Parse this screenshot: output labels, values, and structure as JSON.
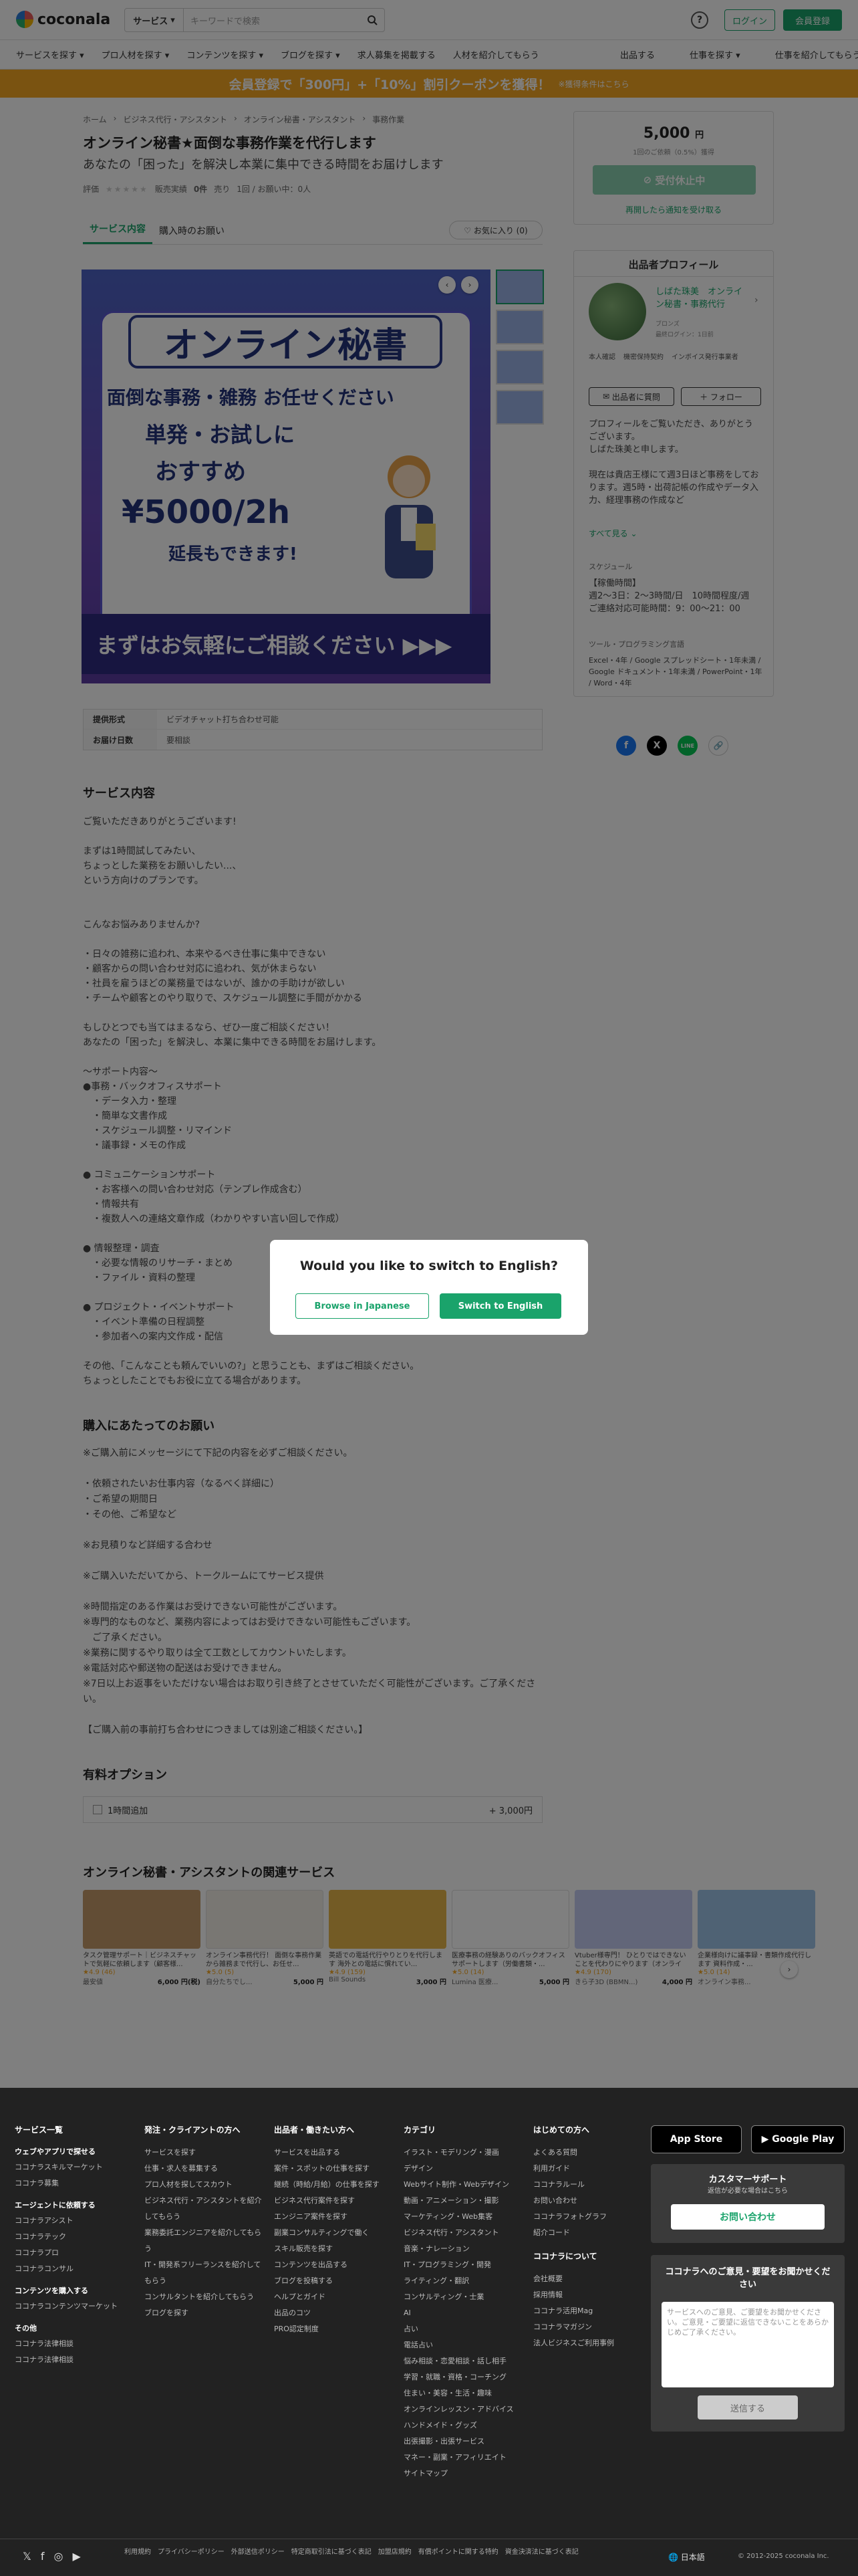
{
  "header": {
    "logo": "coconala",
    "search_category": "サービス",
    "search_placeholder": "キーワードで検索",
    "login": "ログイン",
    "register": "会員登録"
  },
  "nav": {
    "left": [
      "サービスを探す ▾",
      "プロ人材を探す ▾",
      "コンテンツを探す ▾",
      "ブログを探す ▾",
      "求人募集を掲載する",
      "人材を紹介してもらう"
    ],
    "right": [
      "出品する",
      "仕事を探す ▾",
      "仕事を紹介してもらう ▾"
    ]
  },
  "banner": {
    "text": "会員登録で「300円」+「10%」割引クーポンを獲得！",
    "sub": "※獲得条件はこちら"
  },
  "breadcrumb": [
    "ホーム",
    "ビジネス代行・アシスタント",
    "オンライン秘書・アシスタント",
    "事務作業"
  ],
  "title": "オンライン秘書★面倒な事務作業を代行します",
  "subtitle": "あなたの「困った」を解決し本業に集中できる時間をお届けします",
  "meta": {
    "rating_label": "評価",
    "stars": "★★★★★",
    "sales_label": "販売実績",
    "sales": "0件",
    "likes_label": "売り",
    "reply": "1回 / お願い中：0人"
  },
  "tabs": [
    "サービス内容",
    "購入時のお願い"
  ],
  "favorite": "♡ お気に入り (0)",
  "hero": {
    "big": "オンライン秘書",
    "l1": "面倒な事務・雑務 お任せください",
    "l2": "単発・お試しに",
    "l3": "おすすめ",
    "l4": "¥5000/2h",
    "l5": "延長もできます!",
    "foot": "まずはお気軽にご相談ください ▶▶▶"
  },
  "spec": [
    {
      "k": "提供形式",
      "v": "ビデオチャット打ち合わせ可能"
    },
    {
      "k": "お届け日数",
      "v": "要相談"
    }
  ],
  "desc_title": "サービス内容",
  "desc": "ご覧いただきありがとうございます!\n\nまずは1時間試してみたい、\nちょっとした業務をお願いしたい...、\nという方向けのプランです。\n\n\nこんなお悩みありませんか?\n\n・日々の雑務に追われ、本来やるべき仕事に集中できない\n・顧客からの問い合わせ対応に追われ、気が休まらない\n・社員を雇うほどの業務量ではないが、誰かの手助けが欲しい\n・チームや顧客とのやり取りで、スケジュール調整に手間がかかる\n\nもしひとつでも当てはまるなら、ぜひ一度ご相談ください！\nあなたの「困った」を解決し、本業に集中できる時間をお届けします。\n\n〜サポート内容〜\n●事務・バックオフィスサポート\n　・データ入力・整理\n　・簡単な文書作成\n　・スケジュール調整・リマインド\n　・議事録・メモの作成\n\n● コミュニケーションサポート\n　・お客様への問い合わせ対応（テンプレ作成含む）\n　・情報共有\n　・複数人への連絡文章作成（わかりやすい言い回しで作成）\n\n● 情報整理・調査\n　・必要な情報のリサーチ・まとめ\n　・ファイル・資料の整理\n\n● プロジェクト・イベントサポート\n　・イベント準備の日程調整\n　・参加者への案内文作成・配信\n\nその他、「こんなことも頼んでいいの?」と思うことも、まずはご相談ください。\nちょっとしたことでもお役に立てる場合があります。",
  "notes_title": "購入にあたってのお願い",
  "notes": "※ご購入前にメッセージにて下記の内容を必ずご相談ください。\n\n・依頼されたいお仕事内容（なるべく詳細に）\n・ご希望の期間日\n・その他、ご希望など\n\n※お見積りなど詳細する合わせ\n\n※ご購入いただいてから、トークルームにてサービス提供\n\n※時間指定のある作業はお受けできない可能性がございます。\n※専門的なものなど、業務内容によってはお受けできない可能性もございます。\n　ご了承ください。\n※業務に関するやり取りは全て工数としてカウントいたします。\n※電話対応や郵送物の配送はお受けできません。\n※7日以上お返事をいただけない場合はお取り引き終了とさせていただく可能性がございます。ご了承ください。\n\n【ご購入前の事前打ち合わせにつきましては別途ご相談ください。】",
  "option_title": "有料オプション",
  "option": {
    "label": "1時間追加",
    "price": "+ 3,000円"
  },
  "related_title": "オンライン秘書・アシスタントの関連サービス",
  "related": [
    {
      "t": "タスク管理サポート｜ビジネスチャットで気軽に依頼します（顧客様...",
      "r": "★4.9 (46)",
      "s": "最安値",
      "p": "6,000 円(税)",
      "c": "#c59a6b"
    },
    {
      "t": "オンライン事務代行！ 面倒な事務作業から雑務まで代行し、お任せ...",
      "r": "★5.0 (5)",
      "s": "自分たちでし...",
      "p": "5,000 円",
      "c": "#f2efe6"
    },
    {
      "t": "英語での電話代行やりとりを代行します 海外との電話に慣れてい...",
      "r": "★4.9 (159)",
      "s": "Bill Sounds",
      "p": "3,000 円",
      "c": "#e7b64a"
    },
    {
      "t": "医療事務の経験ありのバックオフィスサポートします（労働書類・...",
      "r": "★5.0 (14)",
      "s": "Lumina 医療...",
      "p": "5,000 円",
      "c": "#fff"
    },
    {
      "t": "Vtuber様専門！ ひとりではできないことを代わりにやります（オンライン...",
      "r": "★4.9 (170)",
      "s": "きら子3D (BBMN...)",
      "p": "4,000 円",
      "c": "#c4cdf3"
    },
    {
      "t": "企業様向けに議事録・書類作成代行します 資料作成・...",
      "r": "★5.0 (14)",
      "s": "オンライン事務...",
      "p": "",
      "c": "#9fc4e8"
    }
  ],
  "seller": {
    "price": "5,000",
    "yen": "円",
    "note": "1回のご依頼（0.5%）獲得",
    "stop": "受付休止中",
    "link": "再開したら通知を受け取る",
    "profile_title": "出品者プロフィール",
    "name": "しばた珠美　オンライン秘書・事務代行",
    "rank": "ブロンズ",
    "login": "最終ログイン：1日前",
    "ids": [
      "本人確認",
      "機密保持契約",
      "インボイス発行事業者"
    ],
    "msg": "出品者に質問",
    "follow": "＋ フォロー",
    "intro": "プロフィールをご覧いただき、ありがとうございます。\nしばた珠美と申します。\n\n現在は貴店王様にて週3日ほど事務をしております。週5時・出荷記帳の作成やデータ入力、経理事務の作成など",
    "more": "すべて見る ⌄",
    "sched_label": "スケジュール",
    "sched": "【稼働時間】\n週2〜3日：2〜3時間/日　10時間程度/週\nご連絡対応可能時間：9：00〜21：00",
    "skill_label": "ツール・プログラミング言語",
    "skill": "Excel・4年 / Google スプレッドシート・1年未満 / Google ドキュメント・1年未満 / PowerPoint・1年 / Word・4年"
  },
  "share": [
    "f",
    "X",
    "LINE",
    "🔗"
  ],
  "modal": {
    "question": "Would you like to switch to English?",
    "ja": "Browse in Japanese",
    "en": "Switch to English"
  },
  "footer": {
    "cols": [
      {
        "h": "サービス一覧",
        "items": [
          "ウェブやアプリで探せる",
          "ココナラスキルマーケット",
          "ココナラ募集",
          "エージェントに依頼する",
          "ココナラアシスト",
          "ココナラテック",
          "ココナラプロ",
          "ココナラコンサル",
          "コンテンツを購入する",
          "ココナラコンテンツマーケット",
          "その他",
          "ココナラ法律相談",
          "ココナラ法律相談"
        ]
      },
      {
        "h": "発注・クライアントの方へ",
        "items": [
          "サービスを探す",
          "仕事・求人を募集する",
          "プロ人材を探してスカウト",
          "ビジネス代行・アシスタントを紹介してもらう",
          "業務委託エンジニアを紹介してもらう",
          "IT・開発系フリーランスを紹介してもらう",
          "コンサルタントを紹介してもらう",
          "ブログを探す"
        ]
      },
      {
        "h": "出品者・働きたい方へ",
        "items": [
          "サービスを出品する",
          "案件・スポットの仕事を探す",
          "継続（時給/月給）の仕事を探す",
          "ビジネス代行案件を探す",
          "エンジニア案件を探す",
          "副業コンサルティングで働く",
          "スキル販売を探す",
          "コンテンツを出品する",
          "ブログを投稿する",
          "ヘルプとガイド",
          "出品のコツ",
          "PRO認定制度"
        ]
      },
      {
        "h": "カテゴリ",
        "items": [
          "イラスト・モデリング・漫画",
          "デザイン",
          "Webサイト制作・Webデザイン",
          "動画・アニメーション・撮影",
          "マーケティング・Web集客",
          "ビジネス代行・アシスタント",
          "音楽・ナレーション",
          "IT・プログラミング・開発",
          "ライティング・翻訳",
          "コンサルティング・士業",
          "AI",
          "占い",
          "電話占い",
          "悩み相談・恋愛相談・話し相手",
          "学習・就職・資格・コーチング",
          "住まい・美容・生活・趣味",
          "オンラインレッスン・アドバイス",
          "ハンドメイド・グッズ",
          "出張撮影・出張サービス",
          "マネー・副業・アフィリエイト",
          "サイトマップ"
        ]
      },
      {
        "h": "はじめての方へ",
        "items": [
          "よくある質問",
          "利用ガイド",
          "ココナラルール",
          "お問い合わせ",
          "ココナラフォトグラフ",
          "紹介コード"
        ],
        "h2": "ココナラについて",
        "items2": [
          "会社概要",
          "採用情報",
          "ココナラ活用Mag",
          "ココナラマガジン",
          "法人ビジネスご利用事例"
        ]
      }
    ],
    "appstore": "App Store",
    "gplay": "Google Play",
    "support_h": "カスタマーサポート",
    "support_s": "返信が必要な場合はこちら",
    "contact": "お問い合わせ",
    "fb_h": "ココナラへのご意見・要望をお聞かせください",
    "fb_ph": "サービスへのご意見、ご要望をお聞かせください。ご意見・ご要望に返信できないことをあらかじめご了承ください。",
    "fb_submit": "送信する",
    "links": "利用規約　プライバシーポリシー　外部送信ポリシー　特定商取引法に基づく表記　加盟店規約　有償ポイントに関する特約　資金決済法に基づく表記",
    "lang": "🌐 日本語",
    "copy": "© 2012-2025 coconala Inc."
  }
}
